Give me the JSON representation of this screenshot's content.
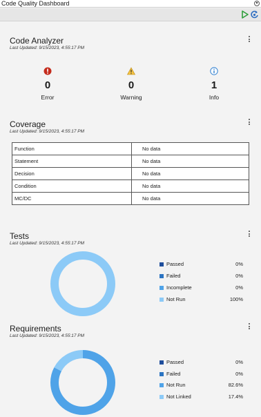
{
  "window": {
    "title": "Code Quality Dashboard"
  },
  "toolbar": {
    "icons": [
      "run-icon",
      "refresh-icon"
    ]
  },
  "code_analyzer": {
    "title": "Code Analyzer",
    "updated": "Last Updated: 9/15/2023, 4:55:17 PM",
    "metrics": [
      {
        "label": "Error",
        "value": "0",
        "icon": "error-icon",
        "color": "#c42b1c"
      },
      {
        "label": "Warning",
        "value": "0",
        "icon": "warning-icon",
        "color": "#e8a317"
      },
      {
        "label": "Info",
        "value": "1",
        "icon": "info-icon",
        "color": "#2f7fd0"
      }
    ]
  },
  "coverage": {
    "title": "Coverage",
    "updated": "Last Updated: 9/15/2023, 4:55:17 PM",
    "rows": [
      {
        "name": "Function",
        "value": "No data"
      },
      {
        "name": "Statement",
        "value": "No data"
      },
      {
        "name": "Decision",
        "value": "No data"
      },
      {
        "name": "Condition",
        "value": "No data"
      },
      {
        "name": "MC/DC",
        "value": "No data"
      }
    ]
  },
  "tests": {
    "title": "Tests",
    "updated": "Last Updated: 9/15/2023, 4:55:17 PM",
    "legend": [
      {
        "label": "Passed",
        "value": "0%",
        "color": "#1f4e9c"
      },
      {
        "label": "Failed",
        "value": "0%",
        "color": "#2b74c2"
      },
      {
        "label": "Incomplete",
        "value": "0%",
        "color": "#4fa3e8"
      },
      {
        "label": "Not Run",
        "value": "100%",
        "color": "#8ccaf7"
      }
    ],
    "donut": [
      {
        "label": "Passed",
        "fraction": 0,
        "color": "#1f4e9c"
      },
      {
        "label": "Failed",
        "fraction": 0,
        "color": "#2b74c2"
      },
      {
        "label": "Incomplete",
        "fraction": 0,
        "color": "#4fa3e8"
      },
      {
        "label": "Not Run",
        "fraction": 1.0,
        "color": "#8ccaf7"
      }
    ]
  },
  "requirements": {
    "title": "Requirements",
    "updated": "Last Updated: 9/15/2023, 4:55:17 PM",
    "legend": [
      {
        "label": "Passed",
        "value": "0%",
        "color": "#1f4e9c"
      },
      {
        "label": "Failed",
        "value": "0%",
        "color": "#2b74c2"
      },
      {
        "label": "Not Run",
        "value": "82.6%",
        "color": "#4fa3e8"
      },
      {
        "label": "Not Linked",
        "value": "17.4%",
        "color": "#8ccaf7"
      }
    ],
    "donut": [
      {
        "label": "Passed",
        "fraction": 0,
        "color": "#1f4e9c"
      },
      {
        "label": "Failed",
        "fraction": 0,
        "color": "#2b74c2"
      },
      {
        "label": "Not Run",
        "fraction": 0.826,
        "color": "#4fa3e8"
      },
      {
        "label": "Not Linked",
        "fraction": 0.174,
        "color": "#8ccaf7"
      }
    ]
  }
}
